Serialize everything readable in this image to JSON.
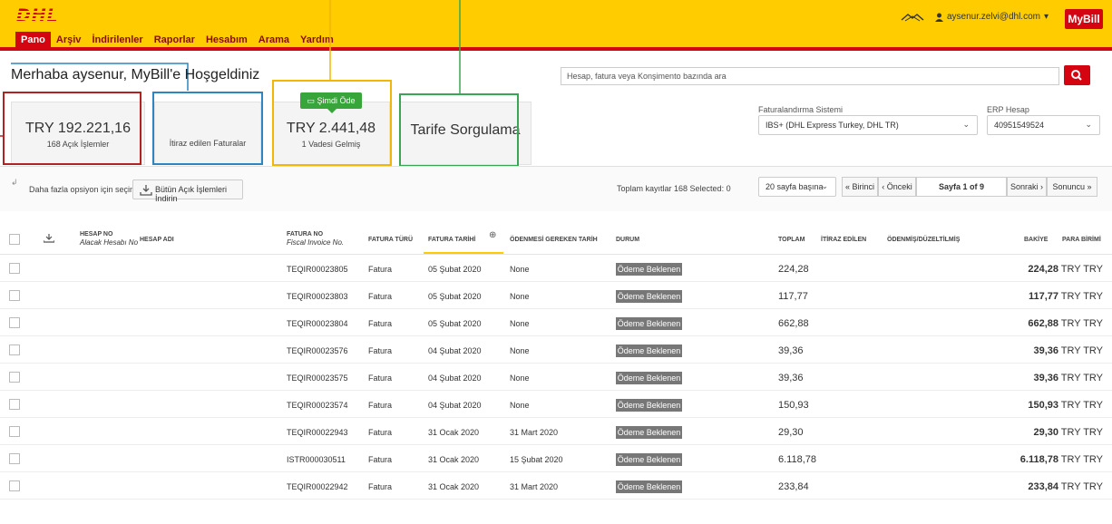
{
  "header": {
    "logo": "DHL",
    "nav": [
      "Pano",
      "Arşiv",
      "İndirilenler",
      "Raporlar",
      "Hesabım",
      "Arama",
      "Yardım"
    ],
    "user_email": "aysenur.zelvi@dhl.com",
    "mybill": "MyBill"
  },
  "greeting": "Merhaba aysenur, MyBill'e Hoşgeldiniz",
  "search": {
    "placeholder": "Hesap, fatura veya Konşimento bazında ara"
  },
  "cards": {
    "open_total": "TRY 192.221,16",
    "open_sub": "168 Açık İşlemler",
    "disputed": "İtiraz edilen Faturalar",
    "pay_badge": "Şimdi Öde",
    "due_total": "TRY 2.441,48",
    "due_sub": "1 Vadesi Gelmiş",
    "tariff": "Tarife Sorgulama"
  },
  "filters": {
    "billing_label": "Faturalandırma Sistemi",
    "billing_value": "IBS+ (DHL Express Turkey, DHL TR)",
    "erp_label": "ERP Hesap",
    "erp_value": "40951549524"
  },
  "toolbar": {
    "more_options": "Daha fazla opsiyon için seçin",
    "download_all": "Bütün Açık İşlemleri İndirin",
    "totals": "Toplam kayıtlar 168   Selected: 0",
    "per_page": "20 sayfa başına",
    "first": "« Birinci",
    "prev": "‹ Önceki",
    "page": "Sayfa 1 of 9",
    "next": "Sonraki ›",
    "last": "Sonuncu »"
  },
  "columns": {
    "account_no": "HESAP NO",
    "account_sub": "Alacak Hesabı No",
    "account_name": "HESAP ADI",
    "invoice_no": "FATURA NO",
    "invoice_sub": "Fiscal Invoice No.",
    "invoice_type": "FATURA TÜRÜ",
    "invoice_date": "FATURA TARİHİ",
    "due_date": "ÖDENMESİ GEREKEN TARİH",
    "status": "DURUM",
    "total": "TOPLAM",
    "disputed": "İTİRAZ EDİLEN",
    "paid_adjusted": "ÖDENMİŞ/DÜZELTİLMİŞ",
    "balance": "BAKİYE",
    "currency": "PARA BİRİMİ"
  },
  "rows": [
    {
      "invoice": "TEQIR00023805",
      "type": "Fatura",
      "date": "05 Şubat 2020",
      "due": "None",
      "status": "Ödeme Beklenen",
      "total": "224,28",
      "balance": "224,28",
      "currency": "TRY TRY"
    },
    {
      "invoice": "TEQIR00023803",
      "type": "Fatura",
      "date": "05 Şubat 2020",
      "due": "None",
      "status": "Ödeme Beklenen",
      "total": "117,77",
      "balance": "117,77",
      "currency": "TRY TRY"
    },
    {
      "invoice": "TEQIR00023804",
      "type": "Fatura",
      "date": "05 Şubat 2020",
      "due": "None",
      "status": "Ödeme Beklenen",
      "total": "662,88",
      "balance": "662,88",
      "currency": "TRY TRY"
    },
    {
      "invoice": "TEQIR00023576",
      "type": "Fatura",
      "date": "04 Şubat 2020",
      "due": "None",
      "status": "Ödeme Beklenen",
      "total": "39,36",
      "balance": "39,36",
      "currency": "TRY TRY"
    },
    {
      "invoice": "TEQIR00023575",
      "type": "Fatura",
      "date": "04 Şubat 2020",
      "due": "None",
      "status": "Ödeme Beklenen",
      "total": "39,36",
      "balance": "39,36",
      "currency": "TRY TRY"
    },
    {
      "invoice": "TEQIR00023574",
      "type": "Fatura",
      "date": "04 Şubat 2020",
      "due": "None",
      "status": "Ödeme Beklenen",
      "total": "150,93",
      "balance": "150,93",
      "currency": "TRY TRY"
    },
    {
      "invoice": "TEQIR00022943",
      "type": "Fatura",
      "date": "31 Ocak 2020",
      "due": "31 Mart 2020",
      "status": "Ödeme Beklenen",
      "total": "29,30",
      "balance": "29,30",
      "currency": "TRY TRY"
    },
    {
      "invoice": "ISTR000030511",
      "type": "Fatura",
      "date": "31 Ocak 2020",
      "due": "15 Şubat 2020",
      "status": "Ödeme Beklenen",
      "total": "6.118,78",
      "balance": "6.118,78",
      "currency": "TRY TRY"
    },
    {
      "invoice": "TEQIR00022942",
      "type": "Fatura",
      "date": "31 Ocak 2020",
      "due": "31 Mart 2020",
      "status": "Ödeme Beklenen",
      "total": "233,84",
      "balance": "233,84",
      "currency": "TRY TRY"
    }
  ],
  "colors": {
    "dhl_yellow": "#ffcc00",
    "dhl_red": "#d40511",
    "highlight_red": "#b22222",
    "highlight_blue": "#2e86c1",
    "highlight_yellow": "#f2b705",
    "highlight_green": "#3aa655",
    "pay_green": "#37a53a"
  }
}
